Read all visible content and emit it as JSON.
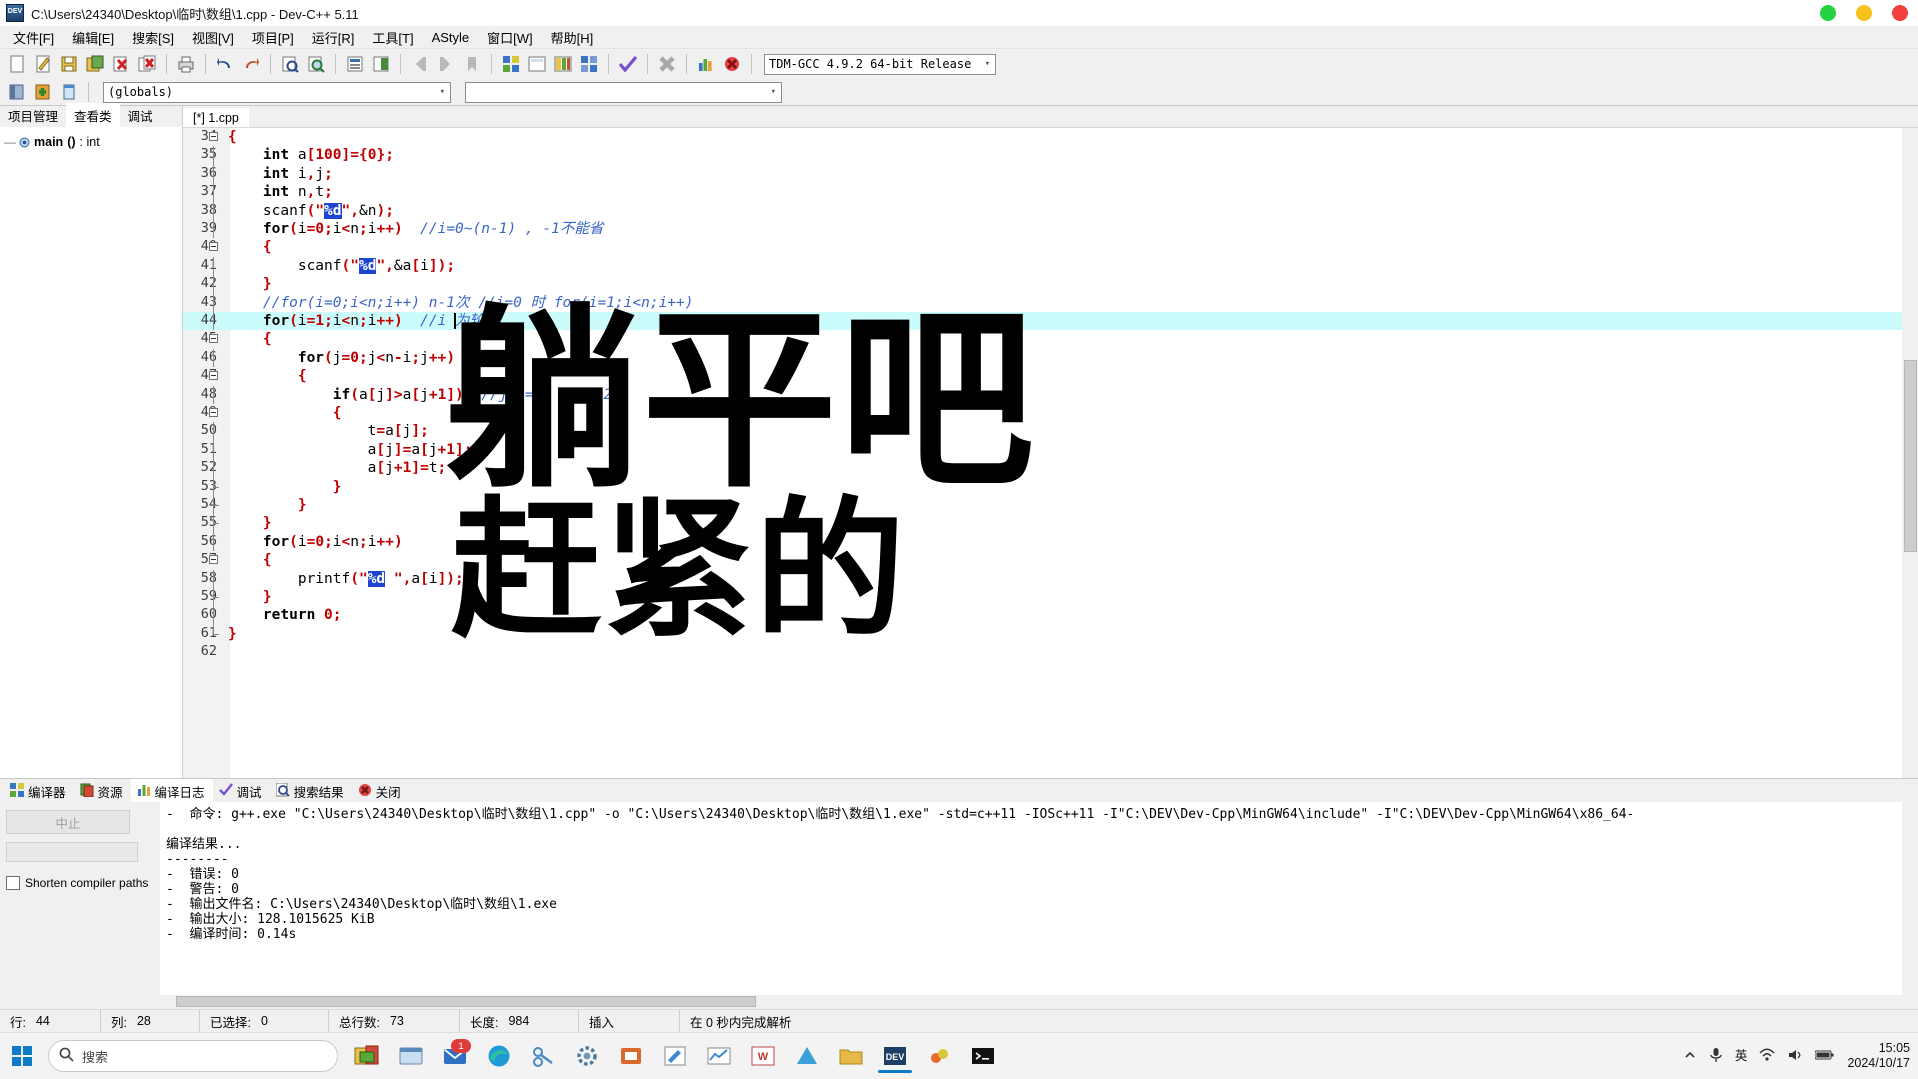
{
  "window": {
    "title": "C:\\Users\\24340\\Desktop\\临时\\数组\\1.cpp - Dev-C++ 5.11",
    "app_icon": "devcpp-icon",
    "controls": {
      "minimize": "minimize-dot",
      "maximize": "maximize-dot",
      "close": "close-dot"
    }
  },
  "menubar": {
    "items": [
      {
        "label": "文件[F]"
      },
      {
        "label": "编辑[E]"
      },
      {
        "label": "搜索[S]"
      },
      {
        "label": "视图[V]"
      },
      {
        "label": "项目[P]"
      },
      {
        "label": "运行[R]"
      },
      {
        "label": "工具[T]"
      },
      {
        "label": "AStyle"
      },
      {
        "label": "窗口[W]"
      },
      {
        "label": "帮助[H]"
      }
    ]
  },
  "toolbar": {
    "compiler_select": "TDM-GCC 4.9.2 64-bit Release",
    "scope_select": "(globals)",
    "secondary_select": ""
  },
  "left_panel": {
    "tabs": [
      {
        "label": "项目管理",
        "active": false
      },
      {
        "label": "查看类",
        "active": true
      },
      {
        "label": "调试",
        "active": false
      }
    ],
    "tree": [
      {
        "name": "main",
        "paren": "()",
        "type": ": int"
      }
    ]
  },
  "editor": {
    "tab_label": "[*] 1.cpp",
    "first_line": 34,
    "lines": [
      {
        "n": 34,
        "fold": true,
        "tokens": [
          {
            "t": "{",
            "c": "br"
          }
        ]
      },
      {
        "n": 35,
        "tokens": [
          {
            "t": "    ",
            "c": "pl"
          },
          {
            "t": "int",
            "c": "kw"
          },
          {
            "t": " a",
            "c": "pl"
          },
          {
            "t": "[",
            "c": "br"
          },
          {
            "t": "100",
            "c": "num"
          },
          {
            "t": "]",
            "c": "br"
          },
          {
            "t": "=",
            "c": "br"
          },
          {
            "t": "{",
            "c": "br"
          },
          {
            "t": "0",
            "c": "num"
          },
          {
            "t": "}",
            "c": "br"
          },
          {
            "t": ";",
            "c": "br"
          }
        ]
      },
      {
        "n": 36,
        "tokens": [
          {
            "t": "    ",
            "c": "pl"
          },
          {
            "t": "int",
            "c": "kw"
          },
          {
            "t": " i",
            "c": "pl"
          },
          {
            "t": ",",
            "c": "br"
          },
          {
            "t": "j",
            "c": "pl"
          },
          {
            "t": ";",
            "c": "br"
          }
        ]
      },
      {
        "n": 37,
        "tokens": [
          {
            "t": "    ",
            "c": "pl"
          },
          {
            "t": "int",
            "c": "kw"
          },
          {
            "t": " n",
            "c": "pl"
          },
          {
            "t": ",",
            "c": "br"
          },
          {
            "t": "t",
            "c": "pl"
          },
          {
            "t": ";",
            "c": "br"
          }
        ]
      },
      {
        "n": 38,
        "tokens": [
          {
            "t": "    scanf",
            "c": "pl"
          },
          {
            "t": "(",
            "c": "br"
          },
          {
            "t": "\"",
            "c": "str"
          },
          {
            "t": "%d",
            "c": "fmt"
          },
          {
            "t": "\"",
            "c": "str"
          },
          {
            "t": ",",
            "c": "br"
          },
          {
            "t": "&n",
            "c": "pl"
          },
          {
            "t": ")",
            "c": "br"
          },
          {
            "t": ";",
            "c": "br"
          }
        ]
      },
      {
        "n": 39,
        "tokens": [
          {
            "t": "    ",
            "c": "pl"
          },
          {
            "t": "for",
            "c": "kw"
          },
          {
            "t": "(",
            "c": "br"
          },
          {
            "t": "i",
            "c": "pl"
          },
          {
            "t": "=",
            "c": "br"
          },
          {
            "t": "0",
            "c": "num"
          },
          {
            "t": ";",
            "c": "br"
          },
          {
            "t": "i",
            "c": "pl"
          },
          {
            "t": "<",
            "c": "br"
          },
          {
            "t": "n",
            "c": "pl"
          },
          {
            "t": ";",
            "c": "br"
          },
          {
            "t": "i",
            "c": "pl"
          },
          {
            "t": "++",
            "c": "br"
          },
          {
            "t": ")",
            "c": "br"
          },
          {
            "t": "  ",
            "c": "pl"
          },
          {
            "t": "//i=0~(n-1) , -1不能省",
            "c": "cmt"
          }
        ]
      },
      {
        "n": 40,
        "fold": true,
        "tokens": [
          {
            "t": "    ",
            "c": "pl"
          },
          {
            "t": "{",
            "c": "br"
          }
        ]
      },
      {
        "n": 41,
        "tokens": [
          {
            "t": "        scanf",
            "c": "pl"
          },
          {
            "t": "(",
            "c": "br"
          },
          {
            "t": "\"",
            "c": "str"
          },
          {
            "t": "%d",
            "c": "fmt"
          },
          {
            "t": "\"",
            "c": "str"
          },
          {
            "t": ",",
            "c": "br"
          },
          {
            "t": "&a",
            "c": "pl"
          },
          {
            "t": "[",
            "c": "br"
          },
          {
            "t": "i",
            "c": "pl"
          },
          {
            "t": "]",
            "c": "br"
          },
          {
            "t": ")",
            "c": "br"
          },
          {
            "t": ";",
            "c": "br"
          }
        ]
      },
      {
        "n": 42,
        "tokens": [
          {
            "t": "    ",
            "c": "pl"
          },
          {
            "t": "}",
            "c": "br"
          }
        ]
      },
      {
        "n": 43,
        "tokens": [
          {
            "t": "    ",
            "c": "pl"
          },
          {
            "t": "//for(i=0;i<n;i++) n-1次 //i=0 时 for(i=1;i<n;i++)",
            "c": "cmt"
          }
        ]
      },
      {
        "n": 44,
        "hl": true,
        "tokens": [
          {
            "t": "    ",
            "c": "pl"
          },
          {
            "t": "for",
            "c": "kw"
          },
          {
            "t": "(",
            "c": "br"
          },
          {
            "t": "i",
            "c": "pl"
          },
          {
            "t": "=",
            "c": "br"
          },
          {
            "t": "1",
            "c": "num"
          },
          {
            "t": ";",
            "c": "br"
          },
          {
            "t": "i",
            "c": "pl"
          },
          {
            "t": "<",
            "c": "br"
          },
          {
            "t": "n",
            "c": "pl"
          },
          {
            "t": ";",
            "c": "br"
          },
          {
            "t": "i",
            "c": "pl"
          },
          {
            "t": "++",
            "c": "br"
          },
          {
            "t": ")",
            "c": "br"
          },
          {
            "t": "  ",
            "c": "pl"
          },
          {
            "t": "//i 为轮数",
            "c": "cmt"
          }
        ]
      },
      {
        "n": 45,
        "fold": true,
        "tokens": [
          {
            "t": "    ",
            "c": "pl"
          },
          {
            "t": "{",
            "c": "br"
          }
        ]
      },
      {
        "n": 46,
        "tokens": [
          {
            "t": "        ",
            "c": "pl"
          },
          {
            "t": "for",
            "c": "kw"
          },
          {
            "t": "(",
            "c": "br"
          },
          {
            "t": "j",
            "c": "pl"
          },
          {
            "t": "=",
            "c": "br"
          },
          {
            "t": "0",
            "c": "num"
          },
          {
            "t": ";",
            "c": "br"
          },
          {
            "t": "j",
            "c": "pl"
          },
          {
            "t": "<",
            "c": "br"
          },
          {
            "t": "n",
            "c": "pl"
          },
          {
            "t": "-",
            "c": "br"
          },
          {
            "t": "i",
            "c": "pl"
          },
          {
            "t": ";",
            "c": "br"
          },
          {
            "t": "j",
            "c": "pl"
          },
          {
            "t": "++",
            "c": "br"
          },
          {
            "t": ")",
            "c": "br"
          }
        ]
      },
      {
        "n": 47,
        "fold": true,
        "tokens": [
          {
            "t": "        ",
            "c": "pl"
          },
          {
            "t": "{",
            "c": "br"
          }
        ]
      },
      {
        "n": 48,
        "tokens": [
          {
            "t": "            ",
            "c": "pl"
          },
          {
            "t": "if",
            "c": "kw"
          },
          {
            "t": "(",
            "c": "br"
          },
          {
            "t": "a",
            "c": "pl"
          },
          {
            "t": "[",
            "c": "br"
          },
          {
            "t": "j",
            "c": "pl"
          },
          {
            "t": "]",
            "c": "br"
          },
          {
            "t": ">",
            "c": "br"
          },
          {
            "t": "a",
            "c": "pl"
          },
          {
            "t": "[",
            "c": "br"
          },
          {
            "t": "j",
            "c": "pl"
          },
          {
            "t": "+",
            "c": "br"
          },
          {
            "t": "1",
            "c": "num"
          },
          {
            "t": "]",
            "c": "br"
          },
          {
            "t": ")",
            "c": "br"
          },
          {
            "t": "  ",
            "c": "pl"
          },
          {
            "t": "//j+1=n   a[n+2]",
            "c": "cmt"
          }
        ]
      },
      {
        "n": 49,
        "fold": true,
        "tokens": [
          {
            "t": "            ",
            "c": "pl"
          },
          {
            "t": "{",
            "c": "br"
          }
        ]
      },
      {
        "n": 50,
        "tokens": [
          {
            "t": "                t",
            "c": "pl"
          },
          {
            "t": "=",
            "c": "br"
          },
          {
            "t": "a",
            "c": "pl"
          },
          {
            "t": "[",
            "c": "br"
          },
          {
            "t": "j",
            "c": "pl"
          },
          {
            "t": "]",
            "c": "br"
          },
          {
            "t": ";",
            "c": "br"
          }
        ]
      },
      {
        "n": 51,
        "tokens": [
          {
            "t": "                a",
            "c": "pl"
          },
          {
            "t": "[",
            "c": "br"
          },
          {
            "t": "j",
            "c": "pl"
          },
          {
            "t": "]",
            "c": "br"
          },
          {
            "t": "=",
            "c": "br"
          },
          {
            "t": "a",
            "c": "pl"
          },
          {
            "t": "[",
            "c": "br"
          },
          {
            "t": "j",
            "c": "pl"
          },
          {
            "t": "+",
            "c": "br"
          },
          {
            "t": "1",
            "c": "num"
          },
          {
            "t": "]",
            "c": "br"
          },
          {
            "t": ";",
            "c": "br"
          }
        ]
      },
      {
        "n": 52,
        "tokens": [
          {
            "t": "                a",
            "c": "pl"
          },
          {
            "t": "[",
            "c": "br"
          },
          {
            "t": "j",
            "c": "pl"
          },
          {
            "t": "+",
            "c": "br"
          },
          {
            "t": "1",
            "c": "num"
          },
          {
            "t": "]",
            "c": "br"
          },
          {
            "t": "=",
            "c": "br"
          },
          {
            "t": "t",
            "c": "pl"
          },
          {
            "t": ";",
            "c": "br"
          }
        ]
      },
      {
        "n": 53,
        "tick": true,
        "tokens": [
          {
            "t": "            ",
            "c": "pl"
          },
          {
            "t": "}",
            "c": "br"
          }
        ]
      },
      {
        "n": 54,
        "tick": true,
        "tokens": [
          {
            "t": "        ",
            "c": "pl"
          },
          {
            "t": "}",
            "c": "br"
          }
        ]
      },
      {
        "n": 55,
        "tick": true,
        "tokens": [
          {
            "t": "    ",
            "c": "pl"
          },
          {
            "t": "}",
            "c": "br"
          }
        ]
      },
      {
        "n": 56,
        "tokens": [
          {
            "t": "    ",
            "c": "pl"
          },
          {
            "t": "for",
            "c": "kw"
          },
          {
            "t": "(",
            "c": "br"
          },
          {
            "t": "i",
            "c": "pl"
          },
          {
            "t": "=",
            "c": "br"
          },
          {
            "t": "0",
            "c": "num"
          },
          {
            "t": ";",
            "c": "br"
          },
          {
            "t": "i",
            "c": "pl"
          },
          {
            "t": "<",
            "c": "br"
          },
          {
            "t": "n",
            "c": "pl"
          },
          {
            "t": ";",
            "c": "br"
          },
          {
            "t": "i",
            "c": "pl"
          },
          {
            "t": "++",
            "c": "br"
          },
          {
            "t": ")",
            "c": "br"
          }
        ]
      },
      {
        "n": 57,
        "fold": true,
        "tokens": [
          {
            "t": "    ",
            "c": "pl"
          },
          {
            "t": "{",
            "c": "br"
          }
        ]
      },
      {
        "n": 58,
        "tokens": [
          {
            "t": "        printf",
            "c": "pl"
          },
          {
            "t": "(",
            "c": "br"
          },
          {
            "t": "\"",
            "c": "str"
          },
          {
            "t": "%d",
            "c": "fmt"
          },
          {
            "t": " \"",
            "c": "str"
          },
          {
            "t": ",",
            "c": "br"
          },
          {
            "t": "a",
            "c": "pl"
          },
          {
            "t": "[",
            "c": "br"
          },
          {
            "t": "i",
            "c": "pl"
          },
          {
            "t": "]",
            "c": "br"
          },
          {
            "t": ")",
            "c": "br"
          },
          {
            "t": ";",
            "c": "br"
          }
        ]
      },
      {
        "n": 59,
        "tick": true,
        "tokens": [
          {
            "t": "    ",
            "c": "pl"
          },
          {
            "t": "}",
            "c": "br"
          }
        ]
      },
      {
        "n": 60,
        "tokens": [
          {
            "t": "    ",
            "c": "pl"
          },
          {
            "t": "return",
            "c": "kw"
          },
          {
            "t": " ",
            "c": "pl"
          },
          {
            "t": "0",
            "c": "num"
          },
          {
            "t": ";",
            "c": "br"
          }
        ]
      },
      {
        "n": 61,
        "endfold": true,
        "tokens": [
          {
            "t": "}",
            "c": "br"
          }
        ]
      },
      {
        "n": 62,
        "tokens": []
      }
    ],
    "overlay_text": {
      "line1": "躺平吧",
      "line2": "赶紧的"
    }
  },
  "bottom_panel": {
    "tabs": [
      {
        "label": "编译器",
        "icon": "grid-icon",
        "active": false
      },
      {
        "label": "资源",
        "icon": "resource-icon",
        "active": false
      },
      {
        "label": "编译日志",
        "icon": "chart-icon",
        "active": true
      },
      {
        "label": "调试",
        "icon": "check-icon",
        "active": false
      },
      {
        "label": "搜索结果",
        "icon": "magnifier-icon",
        "active": false
      },
      {
        "label": "关闭",
        "icon": "close-red-icon",
        "active": false
      }
    ],
    "abort_button": "中止",
    "shorten_label": "Shorten compiler paths",
    "shorten_checked": false,
    "log_lines": [
      "-  命令: g++.exe \"C:\\Users\\24340\\Desktop\\临时\\数组\\1.cpp\" -o \"C:\\Users\\24340\\Desktop\\临时\\数组\\1.exe\" -std=c++11 -IOSc++11 -I\"C:\\DEV\\Dev-Cpp\\MinGW64\\include\" -I\"C:\\DEV\\Dev-Cpp\\MinGW64\\x86_64-",
      "",
      "编译结果...",
      "--------",
      "-  错误: 0",
      "-  警告: 0",
      "-  输出文件名: C:\\Users\\24340\\Desktop\\临时\\数组\\1.exe",
      "-  输出大小: 128.1015625 KiB",
      "-  编译时间: 0.14s"
    ]
  },
  "statusbar": {
    "cells": [
      {
        "label": "行:",
        "value": "44"
      },
      {
        "label": "列:",
        "value": "28"
      },
      {
        "label": "已选择:",
        "value": "0"
      },
      {
        "label": "总行数:",
        "value": "73"
      },
      {
        "label": "长度:",
        "value": "984"
      },
      {
        "label": "插入",
        "value": ""
      },
      {
        "label": "在 0 秒内完成解析",
        "value": ""
      }
    ]
  },
  "taskbar": {
    "search_placeholder": "搜索",
    "clock_time": "15:05",
    "clock_date": "2024/10/17",
    "ime_label": "英",
    "notification_badge": "1"
  }
}
